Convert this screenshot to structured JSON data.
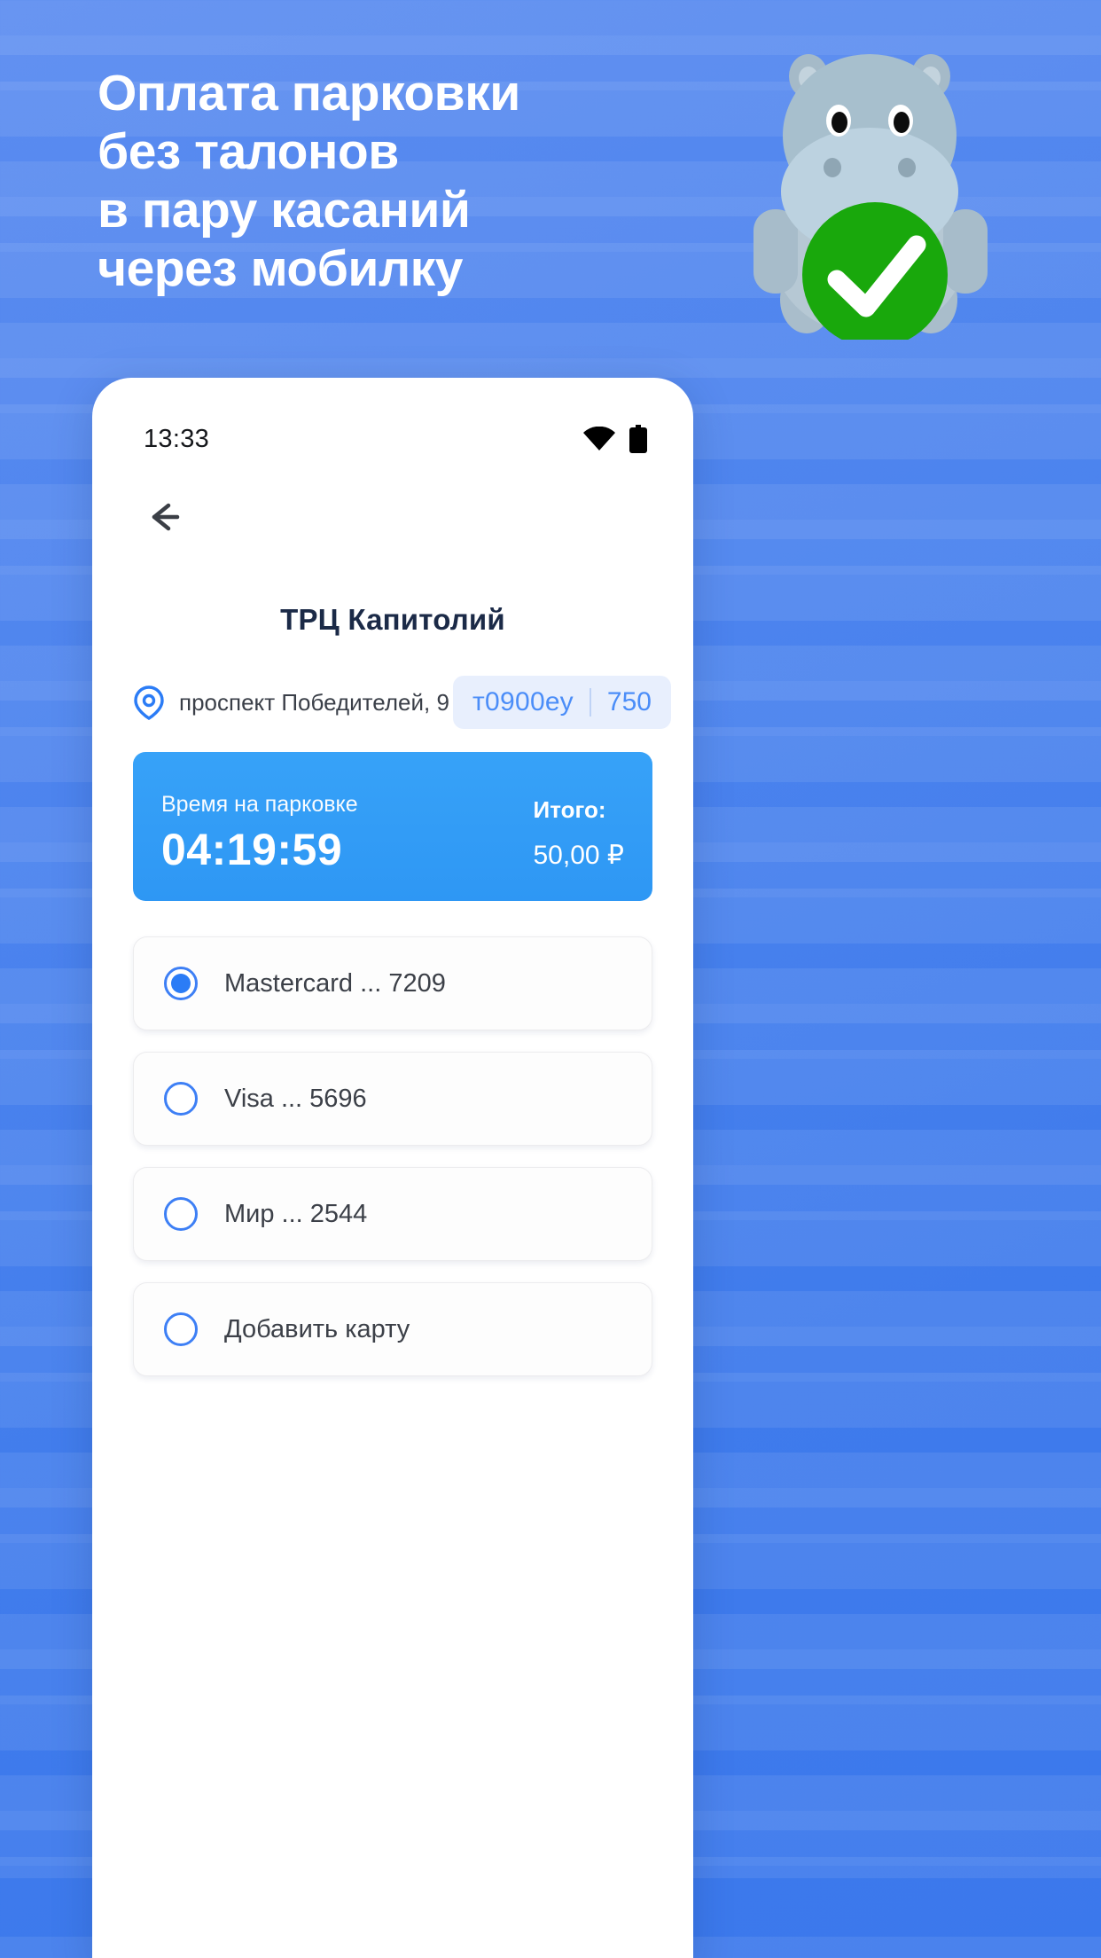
{
  "promo": {
    "headline_lines": [
      "Оплата парковки",
      "без талонов",
      "в пару касаний",
      "через мобилку"
    ],
    "mascot_name": "hippo-mascot",
    "brand_blue": "#4d84ee",
    "check_green": "#19a80c"
  },
  "phone": {
    "status_bar": {
      "time": "13:33",
      "wifi_icon": "wifi-icon",
      "battery_icon": "battery-icon"
    },
    "nav": {
      "back_icon": "arrow-left-icon"
    },
    "venue": {
      "title": "ТРЦ Капитолий",
      "address": "проспект Победителей, 9",
      "address_icon": "location-pin-icon",
      "plate_number": "т0900еу",
      "plate_region": "750"
    },
    "session": {
      "time_label": "Время на парковке",
      "time_value": "04:19:59",
      "total_label": "Итого:",
      "total_value": "50,00 ₽",
      "accent": "#2e97f4"
    },
    "payment_methods": [
      {
        "label": "Mastercard  ... 7209",
        "selected": true
      },
      {
        "label": "Visa  ... 5696",
        "selected": false
      },
      {
        "label": "Мир  ... 2544",
        "selected": false
      },
      {
        "label": "Добавить карту",
        "selected": false
      }
    ]
  }
}
